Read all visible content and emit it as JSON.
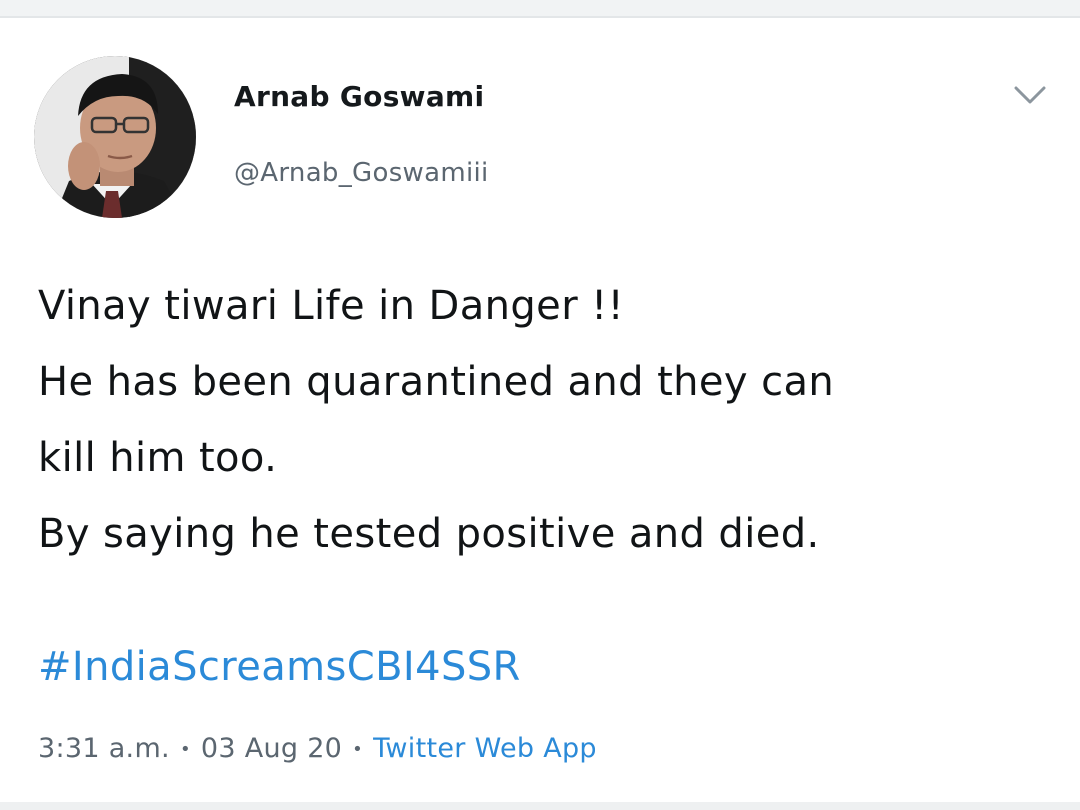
{
  "tweet": {
    "display_name": "Arnab Goswami",
    "handle": "@Arnab_Goswamiii",
    "lines": [
      "Vinay tiwari Life in Danger !!",
      "He has been quarantined and they can",
      "kill him too.",
      "By saying he tested positive and died."
    ],
    "hashtag": "#IndiaScreamsCBI4SSR",
    "time": "3:31 a.m.",
    "date": "03 Aug 20",
    "source": "Twitter Web App"
  },
  "icons": {
    "menu": "chevron-down-icon",
    "avatar": "avatar"
  },
  "colors": {
    "link": "#2b8ad8",
    "secondary_text": "#5b6670"
  }
}
